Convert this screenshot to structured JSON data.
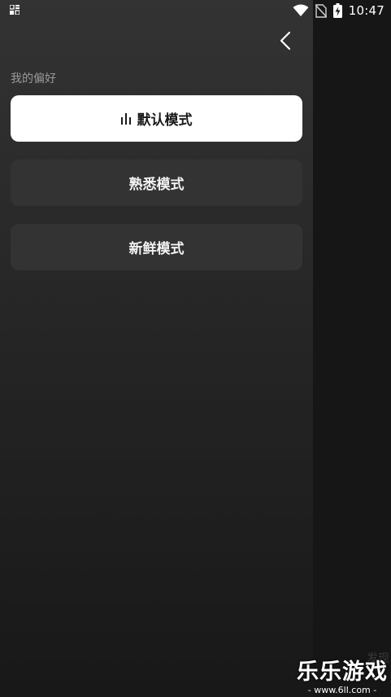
{
  "status_bar": {
    "time": "10:47",
    "left_icon": "notification-icon",
    "icons": [
      "wifi-icon",
      "no-sim-icon",
      "battery-charging-icon"
    ]
  },
  "header": {
    "back_icon": "chevron-left-icon"
  },
  "preferences": {
    "section_title": "我的偏好",
    "options": [
      {
        "label": "默认模式",
        "selected": true,
        "icon": "equalizer-bars-icon"
      },
      {
        "label": "熟悉模式",
        "selected": false
      },
      {
        "label": "新鲜模式",
        "selected": false
      }
    ]
  },
  "watermark": {
    "ghost_text": "发现",
    "brand": "乐乐游戏",
    "url": "- www.6ll.com -"
  },
  "colors": {
    "drawer_top": "#333333",
    "drawer_bottom": "#181818",
    "selected_bg": "#ffffff",
    "unselected_bg": "#333333",
    "section_title": "#9a9a9a"
  }
}
